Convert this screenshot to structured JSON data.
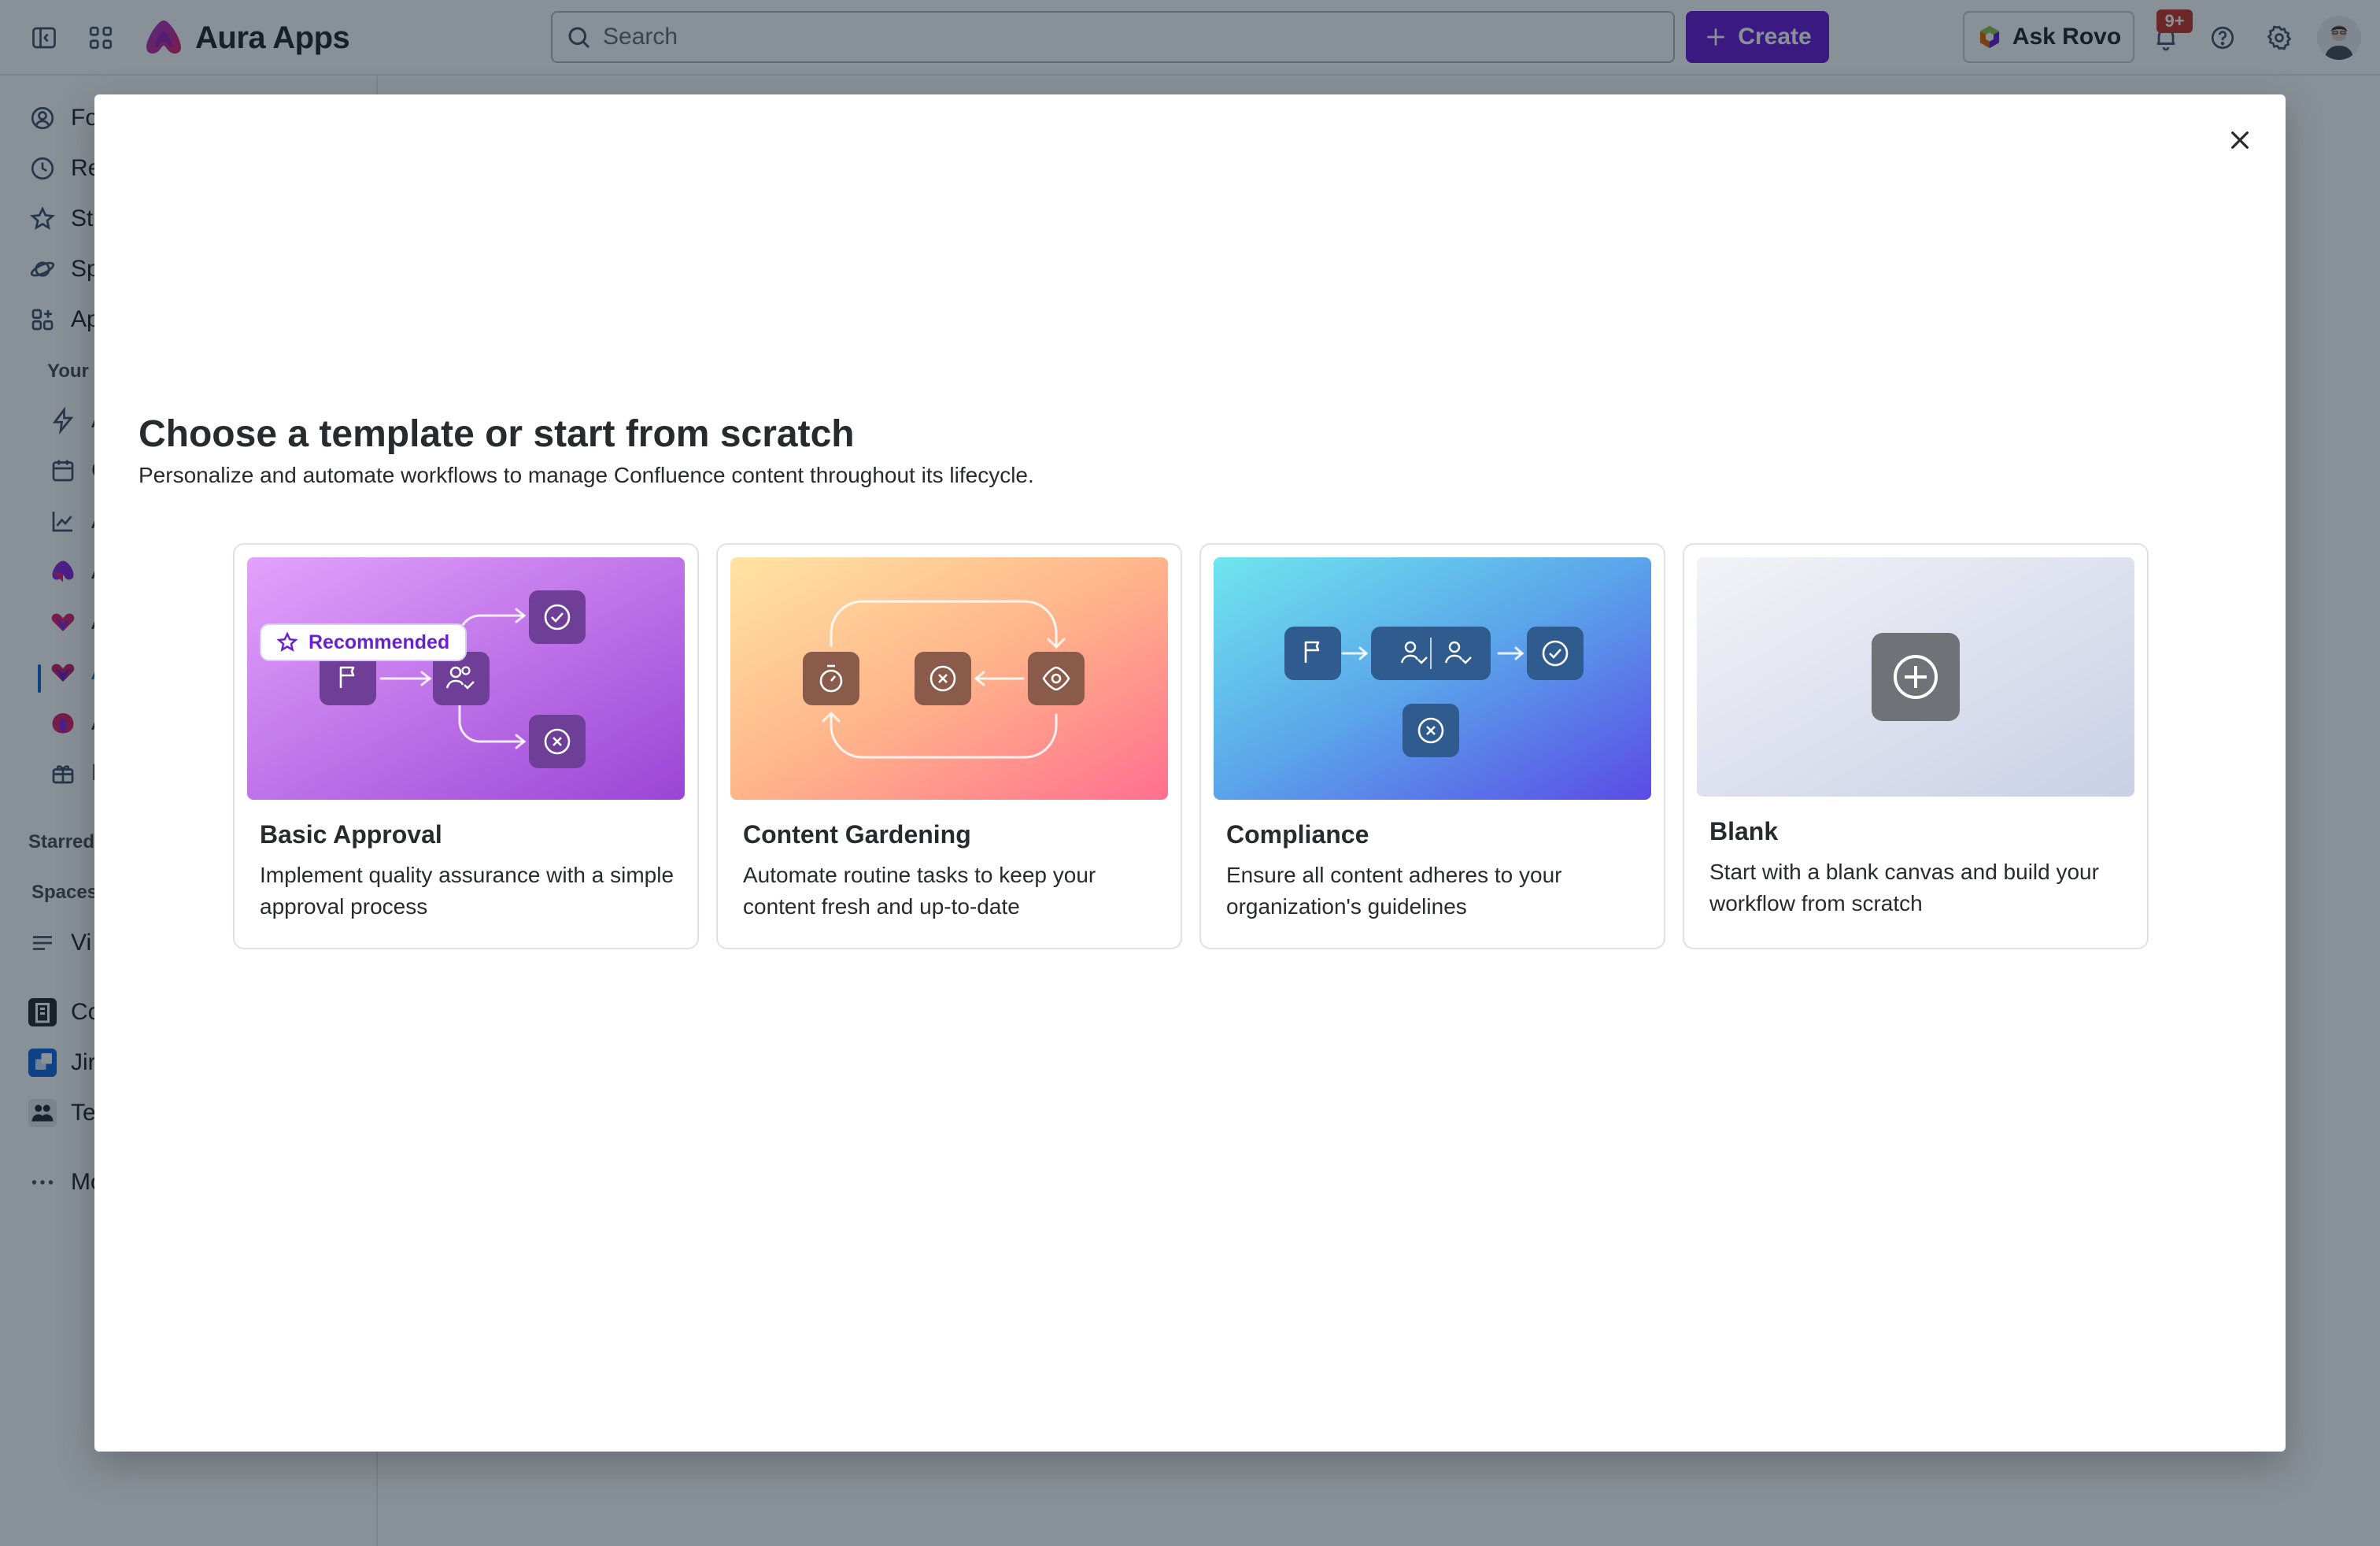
{
  "topbar": {
    "app_name": "Aura Apps",
    "search_placeholder": "Search",
    "create_label": "Create",
    "ask_rovo_label": "Ask Rovo",
    "notification_count": "9+",
    "icons": [
      "sidebar-toggle-icon",
      "app-switcher-icon",
      "bell-icon",
      "help-icon",
      "gear-icon"
    ]
  },
  "sidebar": {
    "items": [
      {
        "label": "Fo",
        "icon": "person-circle-icon"
      },
      {
        "label": "Re",
        "icon": "clock-icon"
      },
      {
        "label": "St",
        "icon": "star-icon"
      },
      {
        "label": "Sp",
        "icon": "planet-icon"
      },
      {
        "label": "Ap",
        "icon": "apps-grid-icon"
      }
    ],
    "section_your": "Your",
    "app_items": [
      {
        "label": "A",
        "icon": "lightning-icon"
      },
      {
        "label": "C",
        "icon": "calendar-icon"
      },
      {
        "label": "A",
        "icon": "chart-line-icon"
      },
      {
        "label": "A",
        "icon": "app-logo-icon"
      },
      {
        "label": "A",
        "icon": "app-logo-icon"
      },
      {
        "label": "A",
        "icon": "app-logo-icon",
        "active": true
      },
      {
        "label": "A",
        "icon": "app-logo-icon"
      },
      {
        "label": "E",
        "icon": "gift-icon"
      }
    ],
    "section_starred": "Starred",
    "section_spaces": "Spaces",
    "spaces": [
      {
        "label": "Vi",
        "icon": "list-icon"
      },
      {
        "label": "Co",
        "icon": "building-icon"
      },
      {
        "label": "Jir",
        "icon": "jira-icon"
      },
      {
        "label": "Te",
        "icon": "team-icon"
      }
    ],
    "more_label": "Mo"
  },
  "modal": {
    "title": "Choose a template or start from scratch",
    "subtitle": "Personalize and automate workflows to manage Confluence content throughout its lifecycle.",
    "recommended_label": "Recommended",
    "cards": [
      {
        "title": "Basic Approval",
        "description": "Implement quality assurance with a simple approval process"
      },
      {
        "title": "Content Gardening",
        "description": "Automate routine tasks to keep your content fresh and up-to-date"
      },
      {
        "title": "Compliance",
        "description": "Ensure all content adheres to your organization's guidelines"
      },
      {
        "title": "Blank",
        "description": "Start with a blank canvas and build your workflow from scratch"
      }
    ]
  },
  "colors": {
    "brand_purple": "#6a1fd1",
    "overlay": "#051524",
    "badge_red": "#c9372c",
    "active_blue": "#1868db"
  }
}
